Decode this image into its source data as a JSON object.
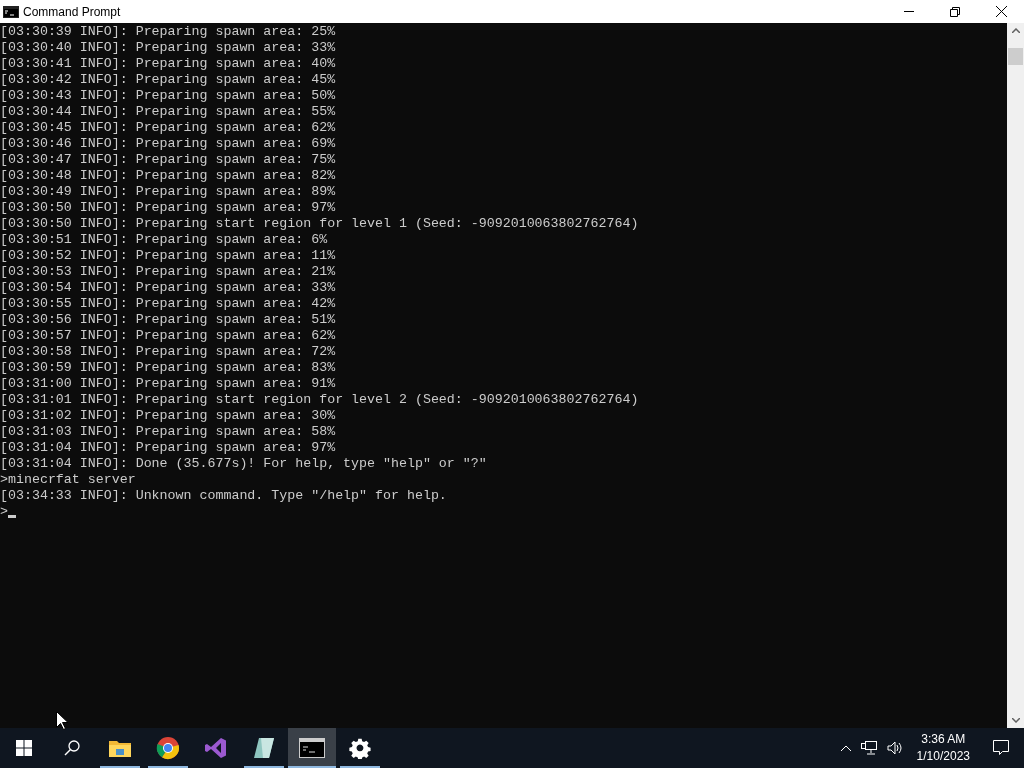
{
  "window": {
    "title": "Command Prompt"
  },
  "console": {
    "lines": [
      "[03:30:39 INFO]: Preparing spawn area: 25%",
      "[03:30:40 INFO]: Preparing spawn area: 33%",
      "[03:30:41 INFO]: Preparing spawn area: 40%",
      "[03:30:42 INFO]: Preparing spawn area: 45%",
      "[03:30:43 INFO]: Preparing spawn area: 50%",
      "[03:30:44 INFO]: Preparing spawn area: 55%",
      "[03:30:45 INFO]: Preparing spawn area: 62%",
      "[03:30:46 INFO]: Preparing spawn area: 69%",
      "[03:30:47 INFO]: Preparing spawn area: 75%",
      "[03:30:48 INFO]: Preparing spawn area: 82%",
      "[03:30:49 INFO]: Preparing spawn area: 89%",
      "[03:30:50 INFO]: Preparing spawn area: 97%",
      "[03:30:50 INFO]: Preparing start region for level 1 (Seed: -9092010063802762764)",
      "[03:30:51 INFO]: Preparing spawn area: 6%",
      "[03:30:52 INFO]: Preparing spawn area: 11%",
      "[03:30:53 INFO]: Preparing spawn area: 21%",
      "[03:30:54 INFO]: Preparing spawn area: 33%",
      "[03:30:55 INFO]: Preparing spawn area: 42%",
      "[03:30:56 INFO]: Preparing spawn area: 51%",
      "[03:30:57 INFO]: Preparing spawn area: 62%",
      "[03:30:58 INFO]: Preparing spawn area: 72%",
      "[03:30:59 INFO]: Preparing spawn area: 83%",
      "[03:31:00 INFO]: Preparing spawn area: 91%",
      "[03:31:01 INFO]: Preparing start region for level 2 (Seed: -9092010063802762764)",
      "[03:31:02 INFO]: Preparing spawn area: 30%",
      "[03:31:03 INFO]: Preparing spawn area: 58%",
      "[03:31:04 INFO]: Preparing spawn area: 97%",
      "[03:31:04 INFO]: Done (35.677s)! For help, type \"help\" or \"?\"",
      ">minecrfat server",
      "[03:34:33 INFO]: Unknown command. Type \"/help\" for help."
    ],
    "prompt": ">"
  },
  "taskbar": {
    "apps": [
      {
        "kind": "folder",
        "running": true,
        "selected": false
      },
      {
        "kind": "browser",
        "running": true,
        "selected": false
      },
      {
        "kind": "studio",
        "running": false,
        "selected": false
      },
      {
        "kind": "notepad",
        "running": true,
        "selected": false
      },
      {
        "kind": "terminal",
        "running": true,
        "selected": true
      },
      {
        "kind": "gear",
        "running": true,
        "selected": false
      }
    ],
    "clock": {
      "time": "3:36 AM",
      "date": "1/10/2023"
    }
  }
}
